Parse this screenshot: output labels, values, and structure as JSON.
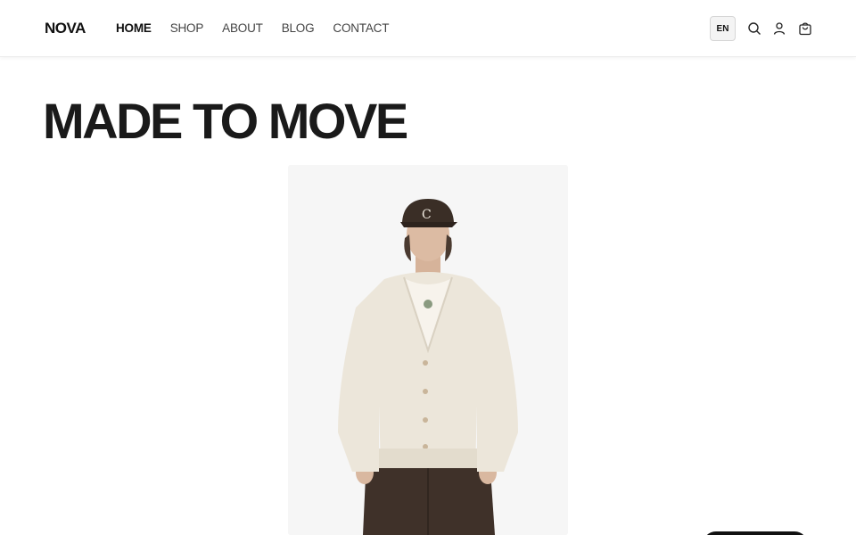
{
  "brand": {
    "logo": "NOVA"
  },
  "nav": {
    "items": [
      {
        "label": "HOME",
        "active": true
      },
      {
        "label": "SHOP",
        "active": false
      },
      {
        "label": "ABOUT",
        "active": false
      },
      {
        "label": "BLOG",
        "active": false
      },
      {
        "label": "CONTACT",
        "active": false
      }
    ]
  },
  "header_actions": {
    "language": "EN",
    "icons": [
      "search-icon",
      "user-icon",
      "cart-icon"
    ]
  },
  "hero": {
    "title": "MADE TO MOVE",
    "image": "model-in-cream-cardigan-and-cap"
  },
  "colors": {
    "text": "#111111",
    "header_bg": "#ffffff",
    "image_bg": "#f6f6f6",
    "cardigan": "#ece6da",
    "trousers": "#3f3129",
    "cap": "#3a2e26"
  }
}
